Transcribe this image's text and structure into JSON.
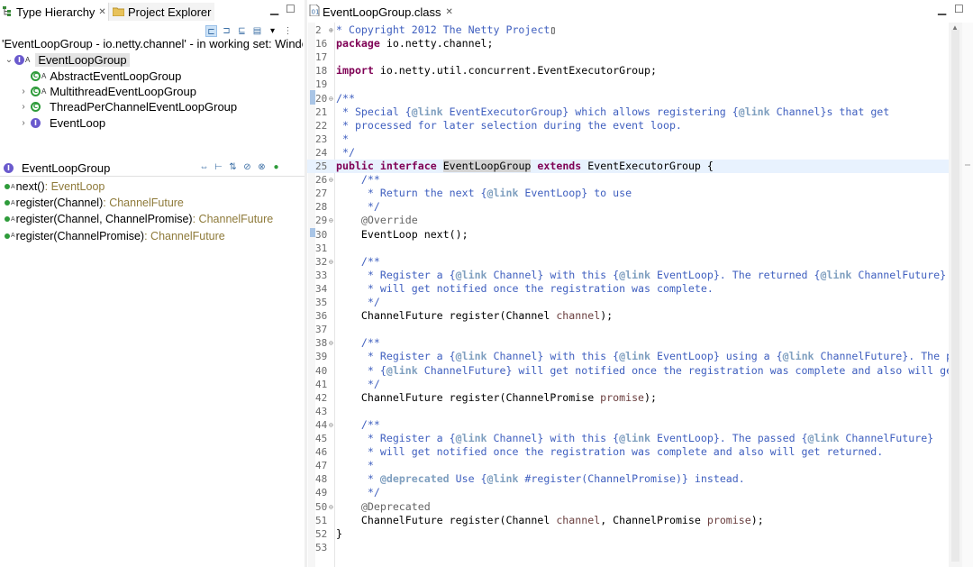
{
  "left_tabs": {
    "type_hierarchy": "Type Hierarchy",
    "project_explorer": "Project Explorer"
  },
  "working_set_line": "'EventLoopGroup - io.netty.channel' - in working set: Window",
  "hierarchy": [
    {
      "label": "EventLoopGroup",
      "kind": "interface",
      "twisty": "expanded",
      "selected": true
    },
    {
      "label": "AbstractEventLoopGroup",
      "kind": "abstract-class",
      "twisty": "none"
    },
    {
      "label": "MultithreadEventLoopGroup",
      "kind": "abstract-class",
      "twisty": "collapsed"
    },
    {
      "label": "ThreadPerChannelEventLoopGroup",
      "kind": "class",
      "twisty": "collapsed"
    },
    {
      "label": "EventLoop",
      "kind": "interface",
      "twisty": "collapsed"
    }
  ],
  "members_header": "EventLoopGroup",
  "members": [
    {
      "name": "next()",
      "ret": " : EventLoop"
    },
    {
      "name": "register(Channel)",
      "ret": " : ChannelFuture"
    },
    {
      "name": "register(Channel, ChannelPromise)",
      "ret": " : ChannelFuture"
    },
    {
      "name": "register(ChannelPromise)",
      "ret": " : ChannelFuture"
    }
  ],
  "editor_tab": "EventLoopGroup.class",
  "colors": {
    "keyword": "#7f0055",
    "javadoc": "#3f5fbf",
    "javadoc_tag": "#7f9fbf",
    "annotation": "#646464",
    "parameter": "#6a3e3e",
    "return_type": "#8e7a3a",
    "current_line": "#e8f2fe"
  },
  "code_lines": [
    {
      "n": "2",
      "fold": "⊕",
      "segs": [
        [
          "cm",
          "* Copyright 2012 The Netty Project"
        ],
        [
          "",
          "▯"
        ]
      ]
    },
    {
      "n": "16",
      "segs": [
        [
          "kw",
          "package"
        ],
        [
          "",
          " io.netty.channel;"
        ]
      ]
    },
    {
      "n": "17",
      "segs": []
    },
    {
      "n": "18",
      "segs": [
        [
          "kw",
          "import"
        ],
        [
          "",
          " io.netty.util.concurrent.EventExecutorGroup;"
        ]
      ]
    },
    {
      "n": "19",
      "segs": []
    },
    {
      "n": "20",
      "fold": "⊖",
      "segs": [
        [
          "cm",
          "/**"
        ]
      ]
    },
    {
      "n": "21",
      "segs": [
        [
          "cm",
          " * Special {"
        ],
        [
          "tag",
          "@link"
        ],
        [
          "cm",
          " EventExecutorGroup} which allows registering {"
        ],
        [
          "tag",
          "@link"
        ],
        [
          "cm",
          " Channel}s that get"
        ]
      ]
    },
    {
      "n": "22",
      "segs": [
        [
          "cm",
          " * processed for later selection during the event loop."
        ]
      ]
    },
    {
      "n": "23",
      "segs": [
        [
          "cm",
          " *"
        ]
      ]
    },
    {
      "n": "24",
      "segs": [
        [
          "cm",
          " */"
        ]
      ]
    },
    {
      "n": "25",
      "cur": true,
      "segs": [
        [
          "kw",
          "public"
        ],
        [
          "",
          " "
        ],
        [
          "kw",
          "interface"
        ],
        [
          "",
          " "
        ],
        [
          "hl",
          "EventLoopGroup"
        ],
        [
          "",
          " "
        ],
        [
          "kw",
          "extends"
        ],
        [
          "",
          " EventExecutorGroup {"
        ]
      ]
    },
    {
      "n": "26",
      "fold": "⊖",
      "segs": [
        [
          "cm",
          "    /**"
        ]
      ]
    },
    {
      "n": "27",
      "segs": [
        [
          "cm",
          "     * Return the next {"
        ],
        [
          "tag",
          "@link"
        ],
        [
          "cm",
          " EventLoop} to use"
        ]
      ]
    },
    {
      "n": "28",
      "segs": [
        [
          "cm",
          "     */"
        ]
      ]
    },
    {
      "n": "29",
      "fold": "⊖",
      "segs": [
        [
          "ann",
          "    @Override"
        ]
      ]
    },
    {
      "n": "30",
      "segs": [
        [
          "",
          "    EventLoop next();"
        ]
      ]
    },
    {
      "n": "31",
      "segs": []
    },
    {
      "n": "32",
      "fold": "⊖",
      "segs": [
        [
          "cm",
          "    /**"
        ]
      ]
    },
    {
      "n": "33",
      "segs": [
        [
          "cm",
          "     * Register a {"
        ],
        [
          "tag",
          "@link"
        ],
        [
          "cm",
          " Channel} with this {"
        ],
        [
          "tag",
          "@link"
        ],
        [
          "cm",
          " EventLoop}. The returned {"
        ],
        [
          "tag",
          "@link"
        ],
        [
          "cm",
          " ChannelFuture}"
        ]
      ]
    },
    {
      "n": "34",
      "segs": [
        [
          "cm",
          "     * will get notified once the registration was complete."
        ]
      ]
    },
    {
      "n": "35",
      "segs": [
        [
          "cm",
          "     */"
        ]
      ]
    },
    {
      "n": "36",
      "segs": [
        [
          "",
          "    ChannelFuture register(Channel "
        ],
        [
          "par",
          "channel"
        ],
        [
          "",
          ");"
        ]
      ]
    },
    {
      "n": "37",
      "segs": []
    },
    {
      "n": "38",
      "fold": "⊖",
      "segs": [
        [
          "cm",
          "    /**"
        ]
      ]
    },
    {
      "n": "39",
      "segs": [
        [
          "cm",
          "     * Register a {"
        ],
        [
          "tag",
          "@link"
        ],
        [
          "cm",
          " Channel} with this {"
        ],
        [
          "tag",
          "@link"
        ],
        [
          "cm",
          " EventLoop} using a {"
        ],
        [
          "tag",
          "@link"
        ],
        [
          "cm",
          " ChannelFuture}. The pas"
        ]
      ]
    },
    {
      "n": "40",
      "segs": [
        [
          "cm",
          "     * {"
        ],
        [
          "tag",
          "@link"
        ],
        [
          "cm",
          " ChannelFuture} will get notified once the registration was complete and also will get"
        ]
      ]
    },
    {
      "n": "41",
      "segs": [
        [
          "cm",
          "     */"
        ]
      ]
    },
    {
      "n": "42",
      "segs": [
        [
          "",
          "    ChannelFuture register(ChannelPromise "
        ],
        [
          "par",
          "promise"
        ],
        [
          "",
          ");"
        ]
      ]
    },
    {
      "n": "43",
      "segs": []
    },
    {
      "n": "44",
      "fold": "⊖",
      "segs": [
        [
          "cm",
          "    /**"
        ]
      ]
    },
    {
      "n": "45",
      "segs": [
        [
          "cm",
          "     * Register a {"
        ],
        [
          "tag",
          "@link"
        ],
        [
          "cm",
          " Channel} with this {"
        ],
        [
          "tag",
          "@link"
        ],
        [
          "cm",
          " EventLoop}. The passed {"
        ],
        [
          "tag",
          "@link"
        ],
        [
          "cm",
          " ChannelFuture}"
        ]
      ]
    },
    {
      "n": "46",
      "segs": [
        [
          "cm",
          "     * will get notified once the registration was complete and also will get returned."
        ]
      ]
    },
    {
      "n": "47",
      "segs": [
        [
          "cm",
          "     *"
        ]
      ]
    },
    {
      "n": "48",
      "segs": [
        [
          "cm",
          "     * "
        ],
        [
          "tag",
          "@deprecated"
        ],
        [
          "cm",
          " Use {"
        ],
        [
          "tag",
          "@link"
        ],
        [
          "cm",
          " #register(ChannelPromise)} instead."
        ]
      ]
    },
    {
      "n": "49",
      "segs": [
        [
          "cm",
          "     */"
        ]
      ]
    },
    {
      "n": "50",
      "fold": "⊖",
      "segs": [
        [
          "ann",
          "    @Deprecated"
        ]
      ]
    },
    {
      "n": "51",
      "segs": [
        [
          "",
          "    ChannelFuture register(Channel "
        ],
        [
          "par",
          "channel"
        ],
        [
          "",
          ", ChannelPromise "
        ],
        [
          "par",
          "promise"
        ],
        [
          "",
          ");"
        ]
      ]
    },
    {
      "n": "52",
      "segs": [
        [
          "",
          "}"
        ]
      ]
    },
    {
      "n": "53",
      "segs": []
    }
  ]
}
